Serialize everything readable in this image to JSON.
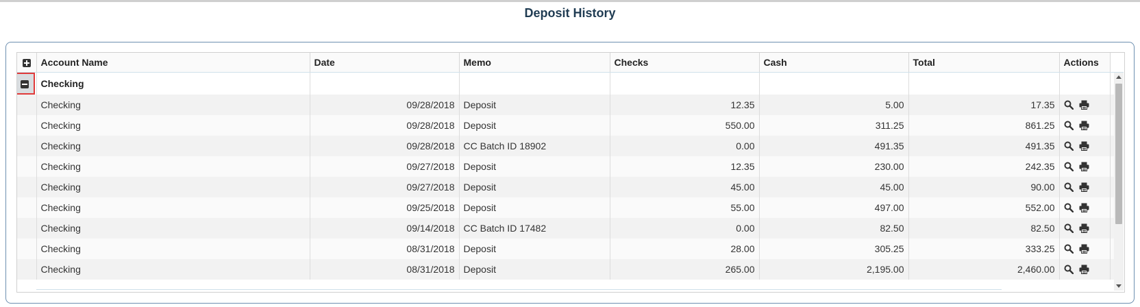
{
  "page": {
    "title": "Deposit History"
  },
  "grid": {
    "columns": {
      "account_name": "Account Name",
      "date": "Date",
      "memo": "Memo",
      "checks": "Checks",
      "cash": "Cash",
      "total": "Total",
      "actions": "Actions"
    },
    "expand_all_icon": "plus-square-icon",
    "group": {
      "label": "Checking",
      "collapse_icon": "minus-square-icon"
    },
    "rows": [
      {
        "account": "Checking",
        "date": "09/28/2018",
        "memo": "Deposit",
        "checks": "12.35",
        "cash": "5.00",
        "total": "17.35"
      },
      {
        "account": "Checking",
        "date": "09/28/2018",
        "memo": "Deposit",
        "checks": "550.00",
        "cash": "311.25",
        "total": "861.25"
      },
      {
        "account": "Checking",
        "date": "09/28/2018",
        "memo": "CC Batch ID 18902",
        "checks": "0.00",
        "cash": "491.35",
        "total": "491.35"
      },
      {
        "account": "Checking",
        "date": "09/27/2018",
        "memo": "Deposit",
        "checks": "12.35",
        "cash": "230.00",
        "total": "242.35"
      },
      {
        "account": "Checking",
        "date": "09/27/2018",
        "memo": "Deposit",
        "checks": "45.00",
        "cash": "45.00",
        "total": "90.00"
      },
      {
        "account": "Checking",
        "date": "09/25/2018",
        "memo": "Deposit",
        "checks": "55.00",
        "cash": "497.00",
        "total": "552.00"
      },
      {
        "account": "Checking",
        "date": "09/14/2018",
        "memo": "CC Batch ID 17482",
        "checks": "0.00",
        "cash": "82.50",
        "total": "82.50"
      },
      {
        "account": "Checking",
        "date": "08/31/2018",
        "memo": "Deposit",
        "checks": "28.00",
        "cash": "305.25",
        "total": "333.25"
      },
      {
        "account": "Checking",
        "date": "08/31/2018",
        "memo": "Deposit",
        "checks": "265.00",
        "cash": "2,195.00",
        "total": "2,460.00"
      }
    ],
    "row_action_icons": [
      "search-icon",
      "print-icon"
    ]
  },
  "colors": {
    "title": "#1f3b52",
    "panel_border": "#6d8fb0",
    "highlight": "#e03a3a"
  }
}
